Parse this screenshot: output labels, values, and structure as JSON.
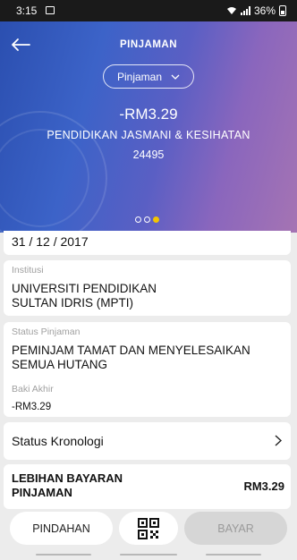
{
  "status_bar": {
    "time": "3:15",
    "battery": "36%"
  },
  "header": {
    "title": "PINJAMAN",
    "dropdown_value": "Pinjaman",
    "amount": "-RM3.29",
    "subject": "PENDIDIKAN JASMANI & KESIHATAN",
    "code": "24495",
    "carousel": {
      "count": 3,
      "active_index": 2
    }
  },
  "details": {
    "date": "31 / 12 / 2017",
    "institution_label": "Institusi",
    "institution_line1": "UNIVERSITI PENDIDIKAN",
    "institution_line2": "SULTAN IDRIS (MPTI)",
    "status_label": "Status Pinjaman",
    "status_line1": "PEMINJAM TAMAT DAN MENYELESAIKAN",
    "status_line2": "SEMUA HUTANG",
    "balance_label": "Baki Akhir",
    "balance_value": "-RM3.29"
  },
  "chronology": {
    "label": "Status Kronologi"
  },
  "overpayment": {
    "label_line1": "LEBIHAN BAYARAN",
    "label_line2": "PINJAMAN",
    "value": "RM3.29"
  },
  "actions": {
    "transfer_label": "PINDAHAN",
    "pay_label": "BAYAR"
  },
  "icons": {
    "back": "arrow-left-icon",
    "dropdown": "chevron-down-icon",
    "chronology": "chevron-right-icon",
    "qr": "qr-code-icon"
  },
  "colors": {
    "accent_yellow": "#f4c400",
    "hero_start": "#2b4fb0",
    "hero_end": "#a574b3",
    "disabled_button": "#d6d6d6"
  }
}
